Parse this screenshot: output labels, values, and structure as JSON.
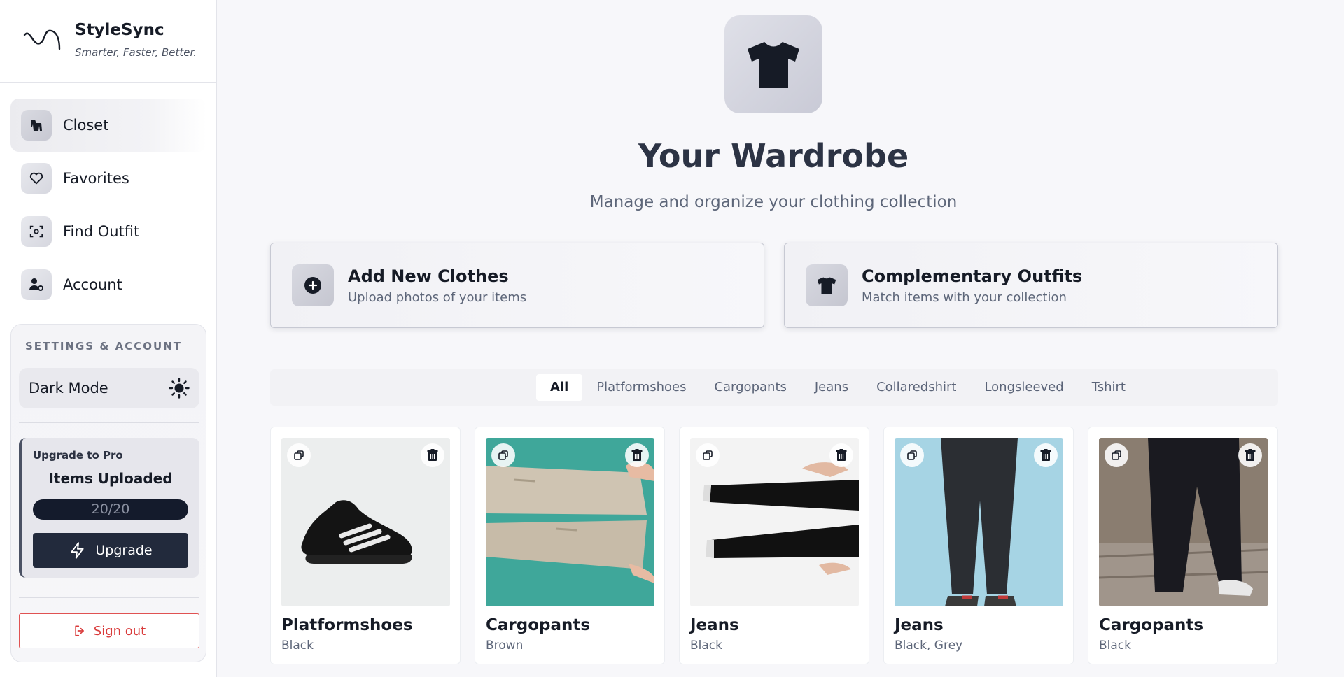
{
  "brand": {
    "name": "StyleSync",
    "tagline": "Smarter, Faster, Better."
  },
  "sidebar": {
    "items": [
      {
        "label": "Closet",
        "icon": "hanger-clothes-icon",
        "active": true
      },
      {
        "label": "Favorites",
        "icon": "heart-icon",
        "active": false
      },
      {
        "label": "Find Outfit",
        "icon": "scan-icon",
        "active": false
      },
      {
        "label": "Account",
        "icon": "user-gear-icon",
        "active": false
      }
    ],
    "settings": {
      "title": "SETTINGS & ACCOUNT",
      "dark_mode_label": "Dark Mode",
      "dark_mode_icon": "sun-icon",
      "upgrade_kicker": "Upgrade to Pro",
      "items_uploaded_label": "Items Uploaded",
      "items_uploaded_value": "20/20",
      "upgrade_button": "Upgrade",
      "sign_out_button": "Sign out"
    }
  },
  "main": {
    "hero_icon": "tshirt-icon",
    "title": "Your Wardrobe",
    "subtitle": "Manage and organize your clothing collection",
    "actions": [
      {
        "title": "Add New Clothes",
        "subtitle": "Upload photos of your items",
        "icon": "plus-circle-icon"
      },
      {
        "title": "Complementary Outfits",
        "subtitle": "Match items with your collection",
        "icon": "tshirt-icon"
      }
    ],
    "filters": [
      "All",
      "Platformshoes",
      "Cargopants",
      "Jeans",
      "Collaredshirt",
      "Longsleeved",
      "Tshirt"
    ],
    "active_filter": "All",
    "items": [
      {
        "name": "Platformshoes",
        "color": "Black"
      },
      {
        "name": "Cargopants",
        "color": "Brown"
      },
      {
        "name": "Jeans",
        "color": "Black"
      },
      {
        "name": "Jeans",
        "color": "Black, Grey"
      },
      {
        "name": "Cargopants",
        "color": "Black"
      }
    ]
  },
  "colors": {
    "accent_dark": "#222a3c",
    "sign_out_red": "#d93b3b"
  }
}
